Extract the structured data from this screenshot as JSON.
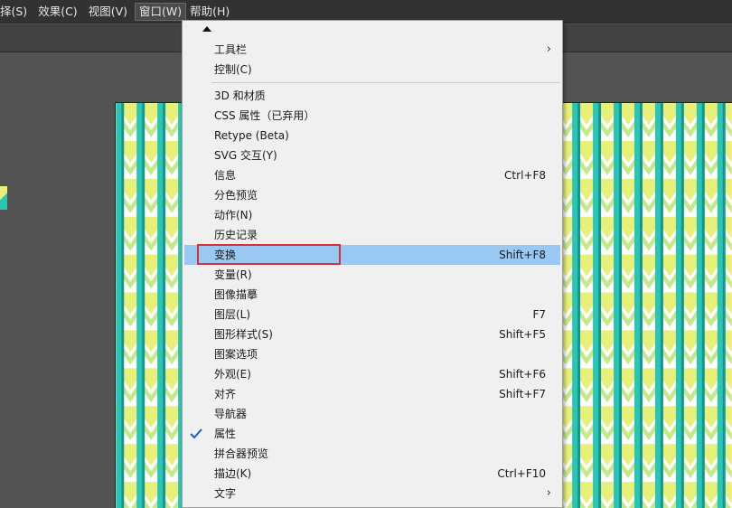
{
  "menubar": {
    "items": [
      {
        "label": "择(S)"
      },
      {
        "label": "效果(C)"
      },
      {
        "label": "视图(V)"
      },
      {
        "label": "窗口(W)"
      },
      {
        "label": "帮助(H)"
      }
    ]
  },
  "window_menu": {
    "items": [
      {
        "label": "工具栏",
        "shortcut": "",
        "submenu": true
      },
      {
        "label": "控制(C)",
        "shortcut": ""
      },
      {
        "label": "3D 和材质",
        "shortcut": ""
      },
      {
        "label": "CSS 属性（已弃用）",
        "shortcut": ""
      },
      {
        "label": "Retype (Beta)",
        "shortcut": ""
      },
      {
        "label": "SVG 交互(Y)",
        "shortcut": ""
      },
      {
        "label": "信息",
        "shortcut": "Ctrl+F8"
      },
      {
        "label": "分色预览",
        "shortcut": ""
      },
      {
        "label": "动作(N)",
        "shortcut": ""
      },
      {
        "label": "历史记录",
        "shortcut": ""
      },
      {
        "label": "变换",
        "shortcut": "Shift+F8",
        "highlighted": true
      },
      {
        "label": "变量(R)",
        "shortcut": ""
      },
      {
        "label": "图像描摹",
        "shortcut": ""
      },
      {
        "label": "图层(L)",
        "shortcut": "F7"
      },
      {
        "label": "图形样式(S)",
        "shortcut": "Shift+F5"
      },
      {
        "label": "图案选项",
        "shortcut": ""
      },
      {
        "label": "外观(E)",
        "shortcut": "Shift+F6"
      },
      {
        "label": "对齐",
        "shortcut": "Shift+F7"
      },
      {
        "label": "导航器",
        "shortcut": ""
      },
      {
        "label": "属性",
        "shortcut": "",
        "checked": true
      },
      {
        "label": "拼合器预览",
        "shortcut": ""
      },
      {
        "label": "描边(K)",
        "shortcut": "Ctrl+F10"
      },
      {
        "label": "文字",
        "shortcut": "",
        "submenu": true
      }
    ]
  },
  "colors": {
    "highlight": "#99c9f3",
    "annotation_box": "#d6303a",
    "pattern_teal": "#2ac5b4",
    "pattern_dark_teal": "#14968e",
    "pattern_yellow": "#e8f07a",
    "pattern_lime": "#c5e98a"
  }
}
